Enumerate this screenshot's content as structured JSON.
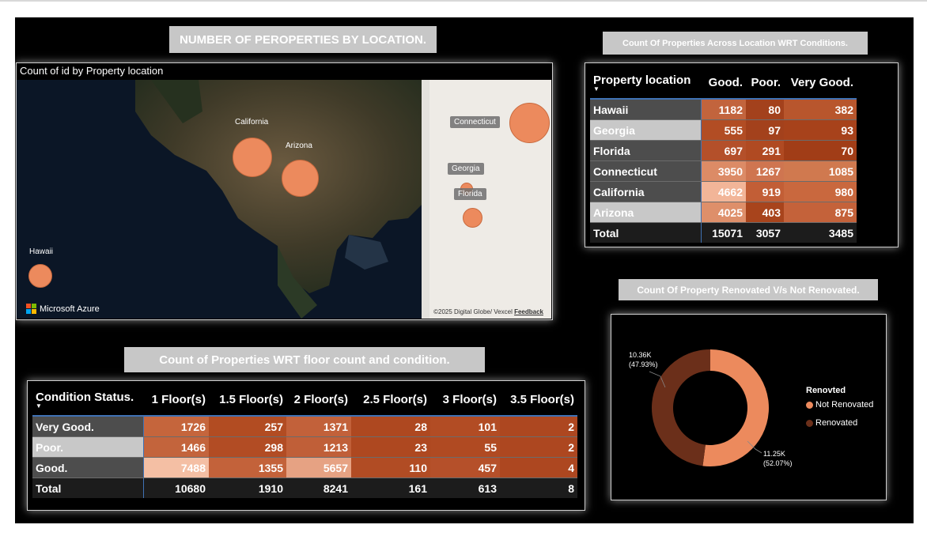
{
  "titles": {
    "map": "NUMBER OF PEROPERTIES BY LOCATION.",
    "conditions": "Count Of Properties Across Location WRT Conditions.",
    "renovated": "Count Of Property Renovated V/s Not Renovated.",
    "floors": "Count of Properties WRT floor count and condition."
  },
  "map": {
    "header": "Count of id by Property location",
    "labels": {
      "california": "California",
      "arizona": "Arizona",
      "hawaii": "Hawaii",
      "connecticut": "Connecticut",
      "georgia": "Georgia",
      "florida": "Florida"
    },
    "brand": "Microsoft Azure",
    "credits": "©2025 Digital Globe/ Vexcel",
    "feedback": "Feedback"
  },
  "conditions_table": {
    "headers": [
      "Property location",
      "Good.",
      "Poor.",
      "Very Good."
    ],
    "rows": [
      {
        "label": "Hawaii",
        "good": "1182",
        "poor": "80",
        "very_good": "382"
      },
      {
        "label": "Georgia",
        "good": "555",
        "poor": "97",
        "very_good": "93"
      },
      {
        "label": "Florida",
        "good": "697",
        "poor": "291",
        "very_good": "70"
      },
      {
        "label": "Connecticut",
        "good": "3950",
        "poor": "1267",
        "very_good": "1085"
      },
      {
        "label": "California",
        "good": "4662",
        "poor": "919",
        "very_good": "980"
      },
      {
        "label": "Arizona",
        "good": "4025",
        "poor": "403",
        "very_good": "875"
      }
    ],
    "total": {
      "label": "Total",
      "good": "15071",
      "poor": "3057",
      "very_good": "3485"
    }
  },
  "floors_table": {
    "headers": [
      "Condition Status.",
      "1 Floor(s)",
      "1.5 Floor(s)",
      "2 Floor(s)",
      "2.5 Floor(s)",
      "3 Floor(s)",
      "3.5 Floor(s)"
    ],
    "rows": [
      {
        "label": "Very Good.",
        "values": [
          "1726",
          "257",
          "1371",
          "28",
          "101",
          "2"
        ]
      },
      {
        "label": "Poor.",
        "values": [
          "1466",
          "298",
          "1213",
          "23",
          "55",
          "2"
        ]
      },
      {
        "label": "Good.",
        "values": [
          "7488",
          "1355",
          "5657",
          "110",
          "457",
          "4"
        ]
      }
    ],
    "total": {
      "label": "Total",
      "values": [
        "10680",
        "1910",
        "8241",
        "161",
        "613",
        "8"
      ]
    }
  },
  "donut": {
    "legend_title": "Renovted",
    "items": [
      {
        "name": "Not Renovated",
        "color": "#ec8a5d"
      },
      {
        "name": "Renovated",
        "color": "#6b2f1a"
      }
    ],
    "label_renovated_value": "10.36K",
    "label_renovated_pct": "(47.93%)",
    "label_not_renovated_value": "11.25K",
    "label_not_renovated_pct": "(52.07%)"
  },
  "chart_data": {
    "type": "pie",
    "categories": [
      "Not Renovated",
      "Renovated"
    ],
    "values": [
      11250,
      10360
    ],
    "percent": [
      52.07,
      47.93
    ],
    "colors": [
      "#ec8a5d",
      "#6b2f1a"
    ],
    "legend": "right"
  }
}
